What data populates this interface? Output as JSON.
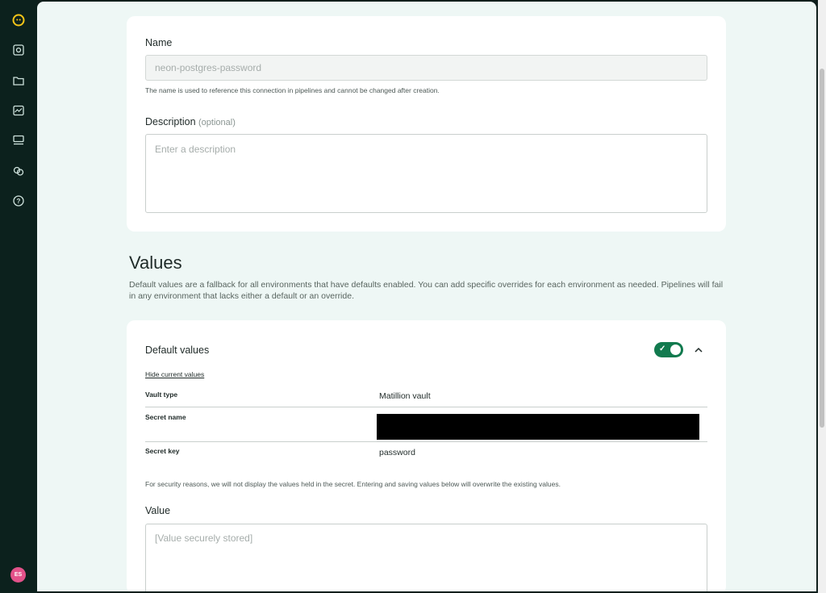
{
  "sidebar": {
    "icons": [
      "logo-icon",
      "pipelines-icon",
      "folder-icon",
      "monitor-icon",
      "storage-icon",
      "connections-icon",
      "help-icon"
    ],
    "avatar_initials": "ES"
  },
  "name_field": {
    "label": "Name",
    "value": "neon-postgres-password",
    "helper": "The name is used to reference this connection in pipelines and cannot be changed after creation."
  },
  "description_field": {
    "label": "Description",
    "optional": "(optional)",
    "placeholder": "Enter a description"
  },
  "values_section": {
    "title": "Values",
    "description": "Default values are a fallback for all environments that have defaults enabled. You can add specific overrides for each environment as needed. Pipelines will fail in any environment that lacks either a default or an override."
  },
  "default_values": {
    "title": "Default values",
    "toggle_on": true,
    "hide_link": "Hide current values",
    "rows": [
      {
        "label": "Vault type",
        "value": "Matillion vault"
      },
      {
        "label": "Secret name",
        "value": ""
      },
      {
        "label": "Secret key",
        "value": "password"
      }
    ],
    "security_note": "For security reasons, we will not display the values held in the secret. Entering and saving values below will overwrite the existing values.",
    "value_label": "Value",
    "value_placeholder": "[Value securely stored]"
  },
  "colors": {
    "sidebar": "#0c211d",
    "accent": "#117a4e",
    "avatar": "#e3528a",
    "logo": "#f5c518"
  }
}
